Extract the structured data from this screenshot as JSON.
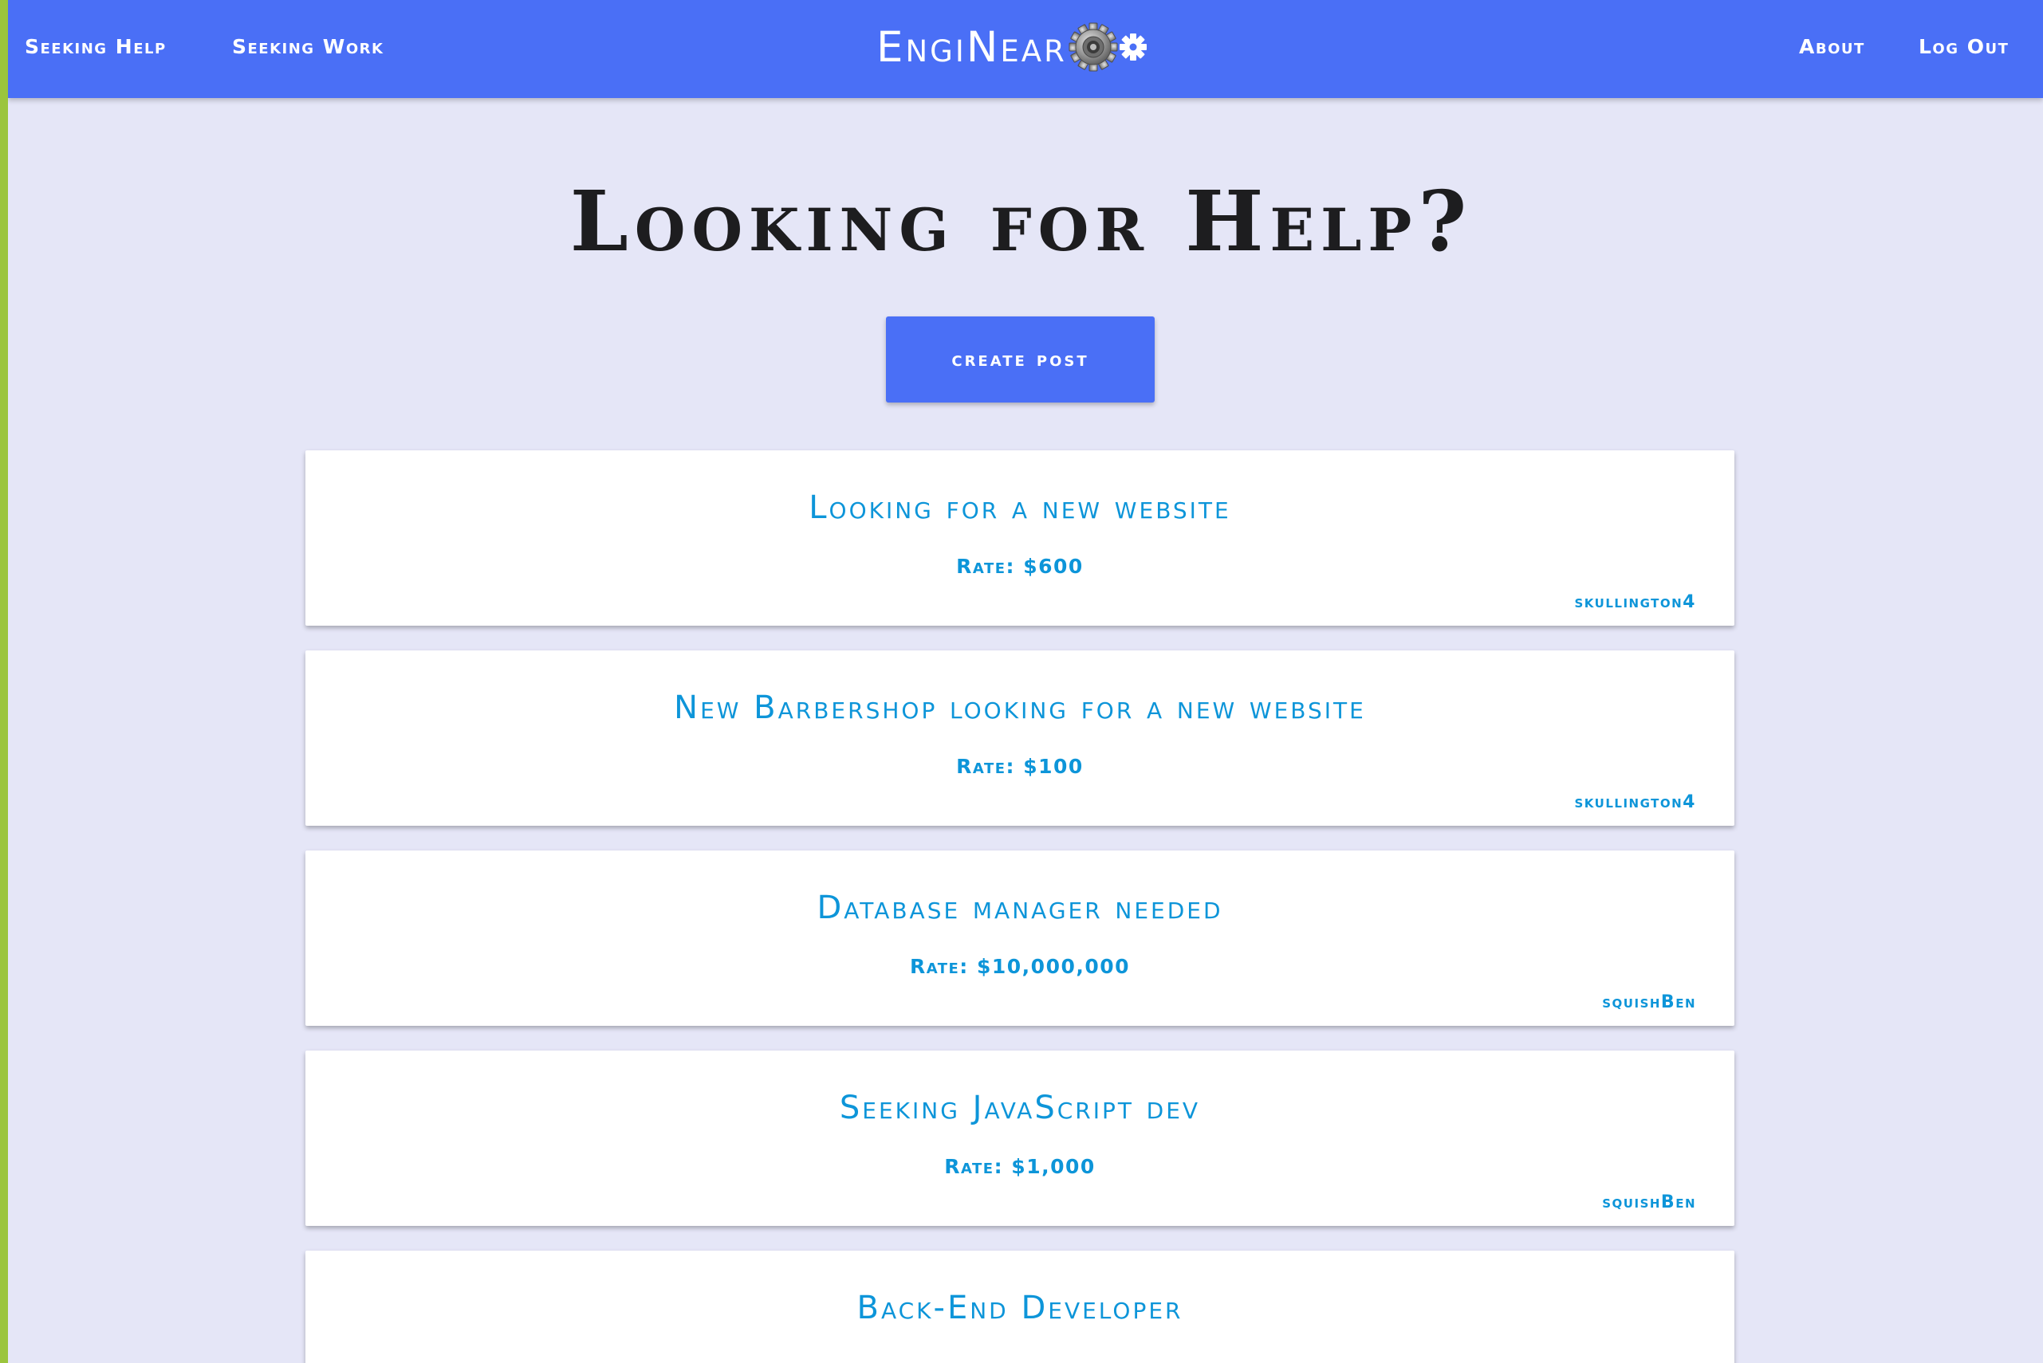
{
  "nav": {
    "seeking_help": "Seeking Help",
    "seeking_work": "Seeking Work",
    "brand": "EngiNear",
    "about": "About",
    "log_out": "Log Out"
  },
  "main": {
    "title": "Looking for Help?",
    "create_post": "create post"
  },
  "posts": [
    {
      "title": "Looking for a new website",
      "rate": "Rate: $600",
      "author": "skullington4"
    },
    {
      "title": "New Barbershop looking for a new website",
      "rate": "Rate: $100",
      "author": "skullington4"
    },
    {
      "title": "Database manager needed",
      "rate": "Rate: $10,000,000",
      "author": "squishBen"
    },
    {
      "title": "Seeking JavaScript dev",
      "rate": "Rate: $1,000",
      "author": "squishBen"
    },
    {
      "title": "Back-End Developer",
      "rate": "",
      "author": ""
    }
  ],
  "colors": {
    "navbar": "#4a6ff6",
    "background": "#e5e6f7",
    "accent_stripe": "#9bc53d",
    "post_text": "#0d95d9",
    "title_text": "#1d1d1f"
  },
  "icons": {
    "brand_large": "gear-icon",
    "brand_small": "cog-icon"
  }
}
